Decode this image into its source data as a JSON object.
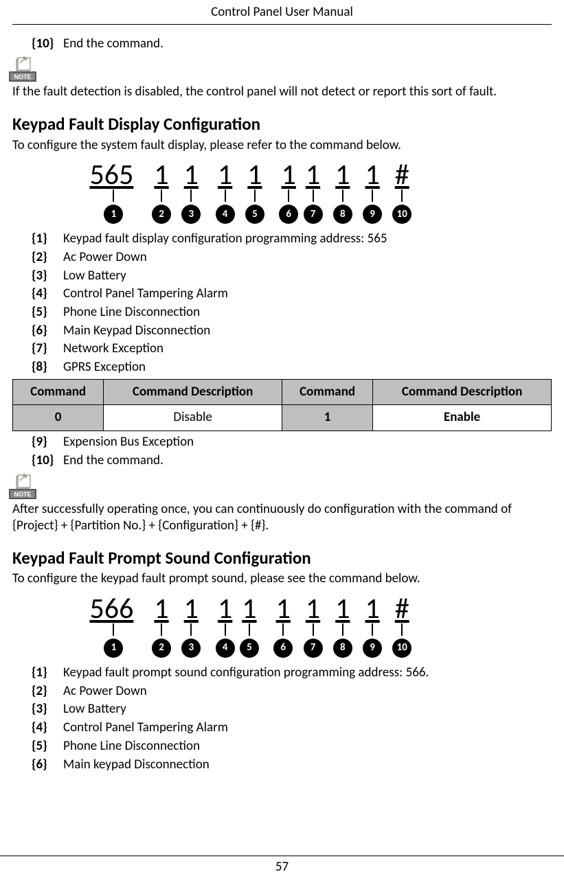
{
  "header": {
    "title": "Control Panel User Manual"
  },
  "footer": {
    "page_number": "57"
  },
  "top_item": {
    "key": "{10}",
    "text": "End the command."
  },
  "note1": {
    "text": "If the fault detection is disabled, the control panel will not detect or report this sort of fault."
  },
  "section1": {
    "title": "Keypad Fault Display Configuration",
    "intro": "To configure the system fault display, please refer to the command below.",
    "command": {
      "digits": [
        "565",
        "1",
        "1",
        "1",
        "1",
        "1",
        "1",
        "1",
        "1",
        "#"
      ],
      "indices": [
        "1",
        "2",
        "3",
        "4",
        "5",
        "6",
        "7",
        "8",
        "9",
        "10"
      ]
    },
    "items_a": [
      {
        "key": "{1}",
        "text": "Keypad fault display configuration programming address: 565"
      },
      {
        "key": "{2}",
        "text": "Ac Power Down"
      },
      {
        "key": "{3}",
        "text": "Low Battery"
      },
      {
        "key": "{4}",
        "text": "Control Panel Tampering Alarm"
      },
      {
        "key": "{5}",
        "text": "Phone Line Disconnection"
      },
      {
        "key": "{6}",
        "text": "Main Keypad Disconnection"
      },
      {
        "key": "{7}",
        "text": "Network Exception"
      },
      {
        "key": "{8}",
        "text": "GPRS Exception"
      }
    ],
    "table": {
      "h1": "Command",
      "h2": "Command Description",
      "h3": "Command",
      "h4": "Command Description",
      "r1c1": "0",
      "r1c2": "Disable",
      "r1c3": "1",
      "r1c4": "Enable"
    },
    "items_b": [
      {
        "key": "{9}",
        "text": "Expension Bus Exception"
      },
      {
        "key": "{10}",
        "text": "End the command."
      }
    ]
  },
  "note2": {
    "text": "After successfully operating once, you can continuously do configuration with the command of {Project} + {Partition No.} + {Configuration} + {#}."
  },
  "section2": {
    "title": "Keypad Fault Prompt Sound Configuration",
    "intro": "To configure the keypad fault prompt sound, please see the command below.",
    "command": {
      "digits": [
        "566",
        "1",
        "1",
        "1",
        "1",
        "1",
        "1",
        "1",
        "1",
        "#"
      ],
      "indices": [
        "1",
        "2",
        "3",
        "4",
        "5",
        "6",
        "7",
        "8",
        "9",
        "10"
      ]
    },
    "items": [
      {
        "key": "{1}",
        "text": "Keypad fault prompt sound configuration programming address: 566."
      },
      {
        "key": "{2}",
        "text": "Ac Power Down"
      },
      {
        "key": "{3}",
        "text": "Low Battery"
      },
      {
        "key": "{4}",
        "text": "Control Panel Tampering Alarm"
      },
      {
        "key": "{5}",
        "text": "Phone Line Disconnection"
      },
      {
        "key": "{6}",
        "text": "Main keypad Disconnection"
      }
    ]
  }
}
